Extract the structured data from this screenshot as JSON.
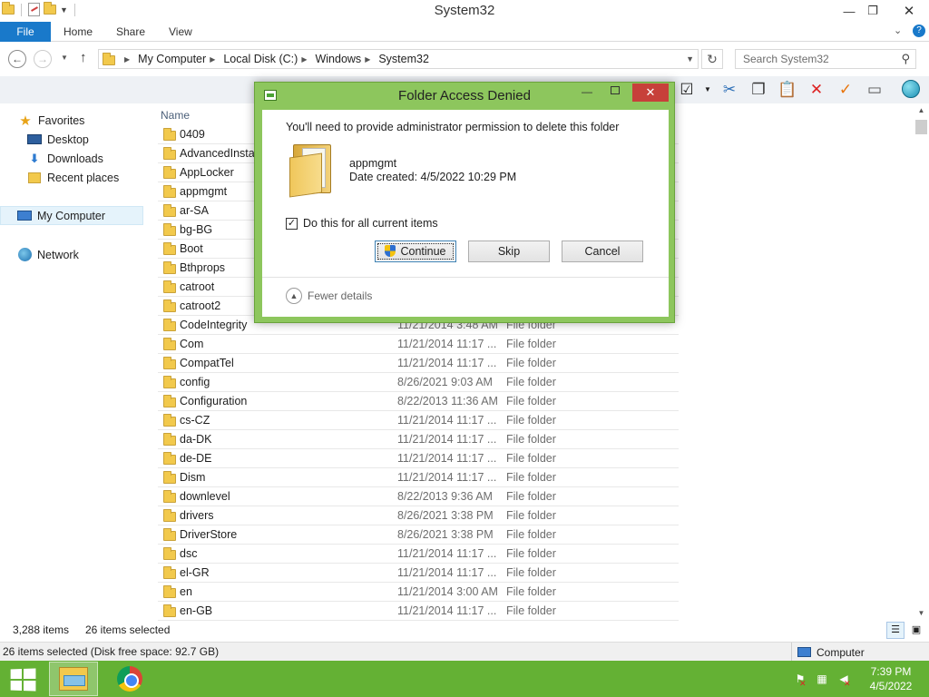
{
  "window": {
    "title": "System32",
    "min_icon": "minimize-icon",
    "max_icon": "restore-icon",
    "close_icon": "close-icon"
  },
  "ribbon": {
    "tabs": [
      "File",
      "Home",
      "Share",
      "View"
    ]
  },
  "address": {
    "crumbs": [
      "My Computer",
      "Local Disk (C:)",
      "Windows",
      "System32"
    ],
    "search_placeholder": "Search System32"
  },
  "nav": {
    "favorites": "Favorites",
    "desktop": "Desktop",
    "downloads": "Downloads",
    "recent": "Recent places",
    "computer": "My Computer",
    "network": "Network"
  },
  "filelist": {
    "col_name": "Name",
    "rows": [
      {
        "name": "0409",
        "date": "",
        "type": ""
      },
      {
        "name": "AdvancedInstall",
        "date": "",
        "type": ""
      },
      {
        "name": "AppLocker",
        "date": "",
        "type": ""
      },
      {
        "name": "appmgmt",
        "date": "",
        "type": ""
      },
      {
        "name": "ar-SA",
        "date": "",
        "type": ""
      },
      {
        "name": "bg-BG",
        "date": "",
        "type": ""
      },
      {
        "name": "Boot",
        "date": "",
        "type": ""
      },
      {
        "name": "Bthprops",
        "date": "",
        "type": ""
      },
      {
        "name": "catroot",
        "date": "",
        "type": ""
      },
      {
        "name": "catroot2",
        "date": "",
        "type": ""
      },
      {
        "name": "CodeIntegrity",
        "date": "11/21/2014 3:48 AM",
        "type": "File folder"
      },
      {
        "name": "Com",
        "date": "11/21/2014 11:17 ...",
        "type": "File folder"
      },
      {
        "name": "CompatTel",
        "date": "11/21/2014 11:17 ...",
        "type": "File folder"
      },
      {
        "name": "config",
        "date": "8/26/2021 9:03 AM",
        "type": "File folder"
      },
      {
        "name": "Configuration",
        "date": "8/22/2013 11:36 AM",
        "type": "File folder"
      },
      {
        "name": "cs-CZ",
        "date": "11/21/2014 11:17 ...",
        "type": "File folder"
      },
      {
        "name": "da-DK",
        "date": "11/21/2014 11:17 ...",
        "type": "File folder"
      },
      {
        "name": "de-DE",
        "date": "11/21/2014 11:17 ...",
        "type": "File folder"
      },
      {
        "name": "Dism",
        "date": "11/21/2014 11:17 ...",
        "type": "File folder"
      },
      {
        "name": "downlevel",
        "date": "8/22/2013 9:36 AM",
        "type": "File folder"
      },
      {
        "name": "drivers",
        "date": "8/26/2021 3:38 PM",
        "type": "File folder"
      },
      {
        "name": "DriverStore",
        "date": "8/26/2021 3:38 PM",
        "type": "File folder"
      },
      {
        "name": "dsc",
        "date": "11/21/2014 11:17 ...",
        "type": "File folder"
      },
      {
        "name": "el-GR",
        "date": "11/21/2014 11:17 ...",
        "type": "File folder"
      },
      {
        "name": "en",
        "date": "11/21/2014 3:00 AM",
        "type": "File folder"
      },
      {
        "name": "en-GB",
        "date": "11/21/2014 11:17 ...",
        "type": "File folder"
      }
    ]
  },
  "status": {
    "count": "3,288 items",
    "selected": "26 items selected"
  },
  "infobar": {
    "text": "26 items selected (Disk free space: 92.7 GB)",
    "zone": "Computer"
  },
  "taskbar": {
    "time": "7:39 PM",
    "date": "4/5/2022"
  },
  "dialog": {
    "title": "Folder Access Denied",
    "message": "You'll need to provide administrator permission to delete this folder",
    "item_name": "appmgmt",
    "item_date": "Date created: 4/5/2022 10:29 PM",
    "checkbox_label": "Do this for all current items",
    "checkbox_checked": true,
    "continue": "Continue",
    "skip": "Skip",
    "cancel": "Cancel",
    "details": "Fewer details"
  }
}
